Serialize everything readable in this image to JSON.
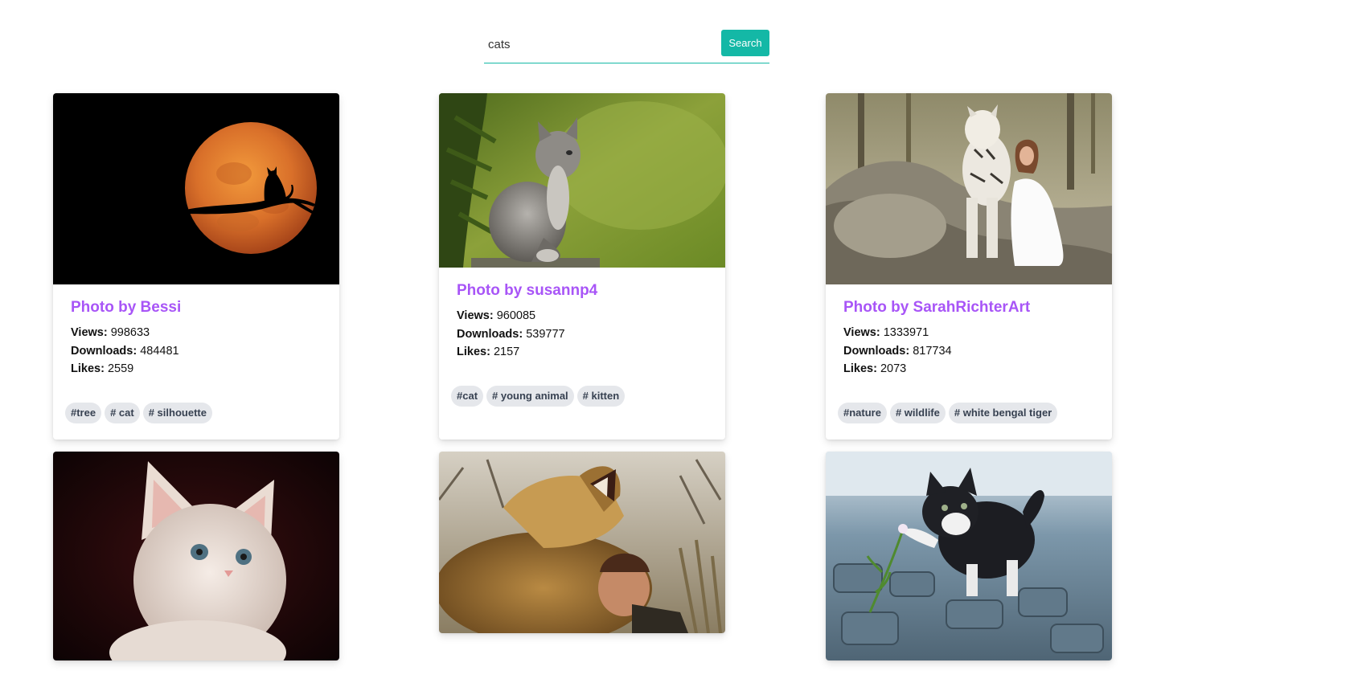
{
  "search": {
    "value": "cats",
    "button_label": "Search"
  },
  "stat_labels": {
    "views": "Views:",
    "downloads": "Downloads:",
    "likes": "Likes:"
  },
  "cards": [
    {
      "title": "Photo by Bessi",
      "views": "998633",
      "downloads": "484481",
      "likes": "2559",
      "tags": [
        "#tree",
        "# cat",
        "# silhouette"
      ]
    },
    {
      "title": "Photo by susannp4",
      "views": "960085",
      "downloads": "539777",
      "likes": "2157",
      "tags": [
        "#cat",
        "# young animal",
        "# kitten"
      ]
    },
    {
      "title": "Photo by SarahRichterArt",
      "views": "1333971",
      "downloads": "817734",
      "likes": "2073",
      "tags": [
        "#nature",
        "# wildlife",
        "# white bengal tiger"
      ]
    }
  ],
  "colors": {
    "accent": "#14b8a6",
    "title": "#a855f7",
    "tag_bg": "#e5e7eb"
  }
}
